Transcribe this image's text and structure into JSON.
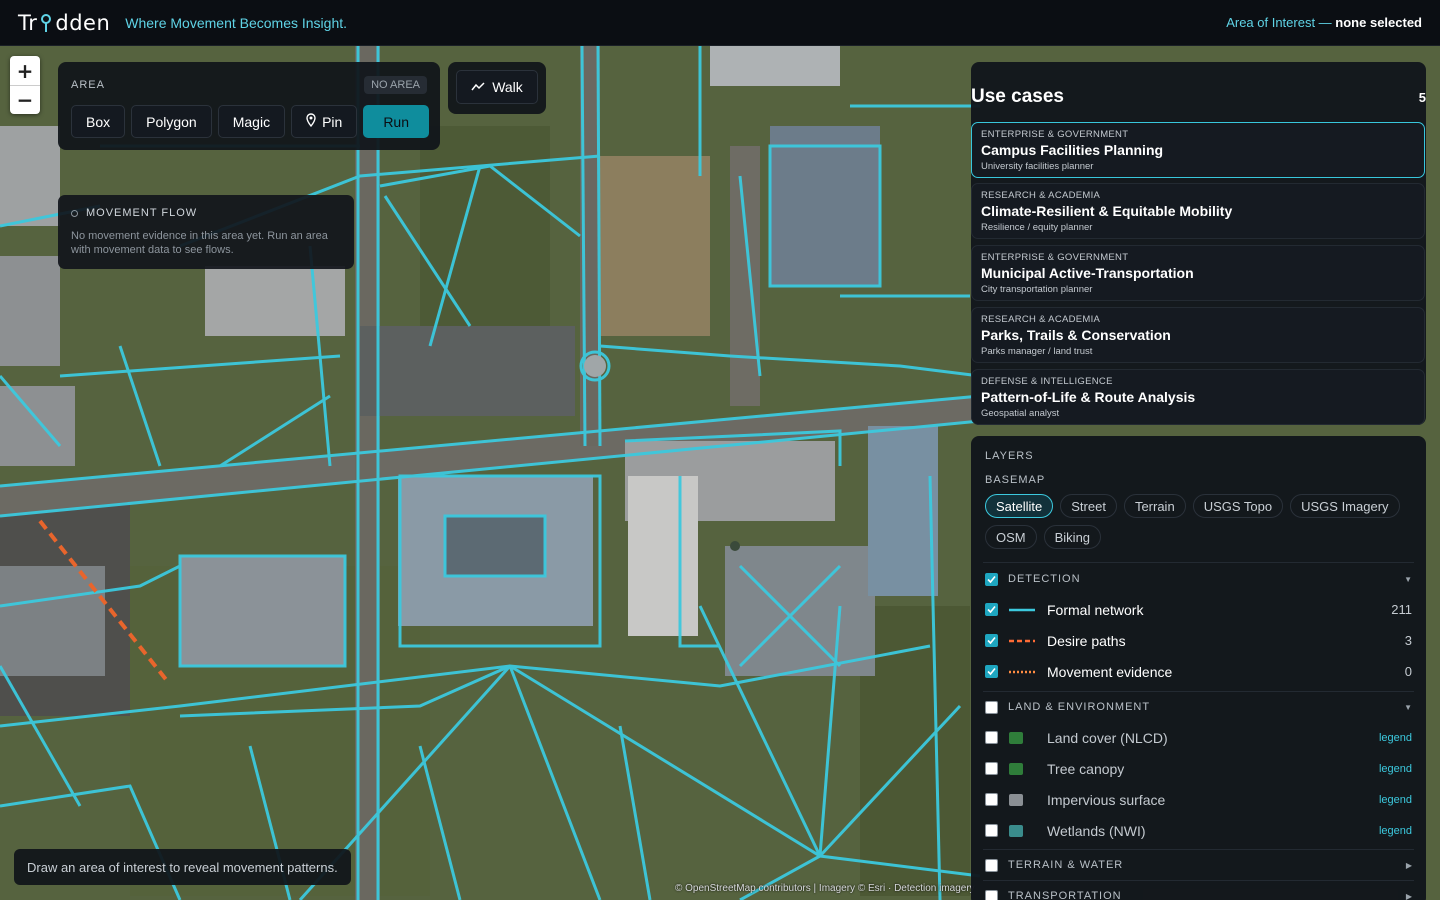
{
  "header": {
    "brand_left": "Tr",
    "brand_right": "dden",
    "tagline": "Where Movement Becomes Insight.",
    "aoi_label": "Area of Interest — ",
    "aoi_value": "none selected"
  },
  "zoom": {
    "in": "+",
    "out": "−"
  },
  "area": {
    "title": "AREA",
    "status": "NO AREA",
    "tools": [
      "Box",
      "Polygon",
      "Magic",
      "Pin"
    ],
    "run": "Run"
  },
  "walk": {
    "label": "Walk"
  },
  "movement_flow": {
    "title": "MOVEMENT FLOW",
    "message": "No movement evidence in this area yet. Run an area with movement data to see flows."
  },
  "hint": "Draw an area of interest to reveal movement patterns.",
  "attribution": "© OpenStreetMap contributors | Imagery © Esri · Detection imagery",
  "use_cases": {
    "title": "Use cases",
    "count": "5",
    "items": [
      {
        "category": "ENTERPRISE & GOVERNMENT",
        "name": "Campus Facilities Planning",
        "subtitle": "University facilities planner"
      },
      {
        "category": "RESEARCH & ACADEMIA",
        "name": "Climate-Resilient & Equitable Mobility",
        "subtitle": "Resilience / equity planner"
      },
      {
        "category": "ENTERPRISE & GOVERNMENT",
        "name": "Municipal Active-Transportation",
        "subtitle": "City transportation planner"
      },
      {
        "category": "RESEARCH & ACADEMIA",
        "name": "Parks, Trails & Conservation",
        "subtitle": "Parks manager / land trust"
      },
      {
        "category": "DEFENSE & INTELLIGENCE",
        "name": "Pattern-of-Life & Route Analysis",
        "subtitle": "Geospatial analyst"
      }
    ]
  },
  "layers": {
    "title": "LAYERS",
    "basemap_label": "BASEMAP",
    "basemaps": [
      "Satellite",
      "Street",
      "Terrain",
      "USGS Topo",
      "USGS Imagery",
      "OSM",
      "Biking"
    ],
    "selected_basemap": "Satellite",
    "detection": {
      "label": "DETECTION",
      "items": [
        {
          "name": "Formal network",
          "count": "211",
          "color": "#3cc9de"
        },
        {
          "name": "Desire paths",
          "count": "3",
          "color": "#ff6b35"
        },
        {
          "name": "Movement evidence",
          "count": "0",
          "color": "#ff8c42"
        }
      ]
    },
    "land": {
      "label": "LAND & ENVIRONMENT",
      "legend_label": "legend",
      "items": [
        {
          "name": "Land cover (NLCD)",
          "color": "#2f7d3a"
        },
        {
          "name": "Tree canopy",
          "color": "#2f7d3a"
        },
        {
          "name": "Impervious surface",
          "color": "#8a8f94"
        },
        {
          "name": "Wetlands (NWI)",
          "color": "#3a8c8c"
        }
      ]
    },
    "terrain_water": "TERRAIN & WATER",
    "transportation": "TRANSPORTATION"
  },
  "colors": {
    "accent": "#3cc9de",
    "run": "#0f8d9d",
    "desire": "#e8652c"
  }
}
